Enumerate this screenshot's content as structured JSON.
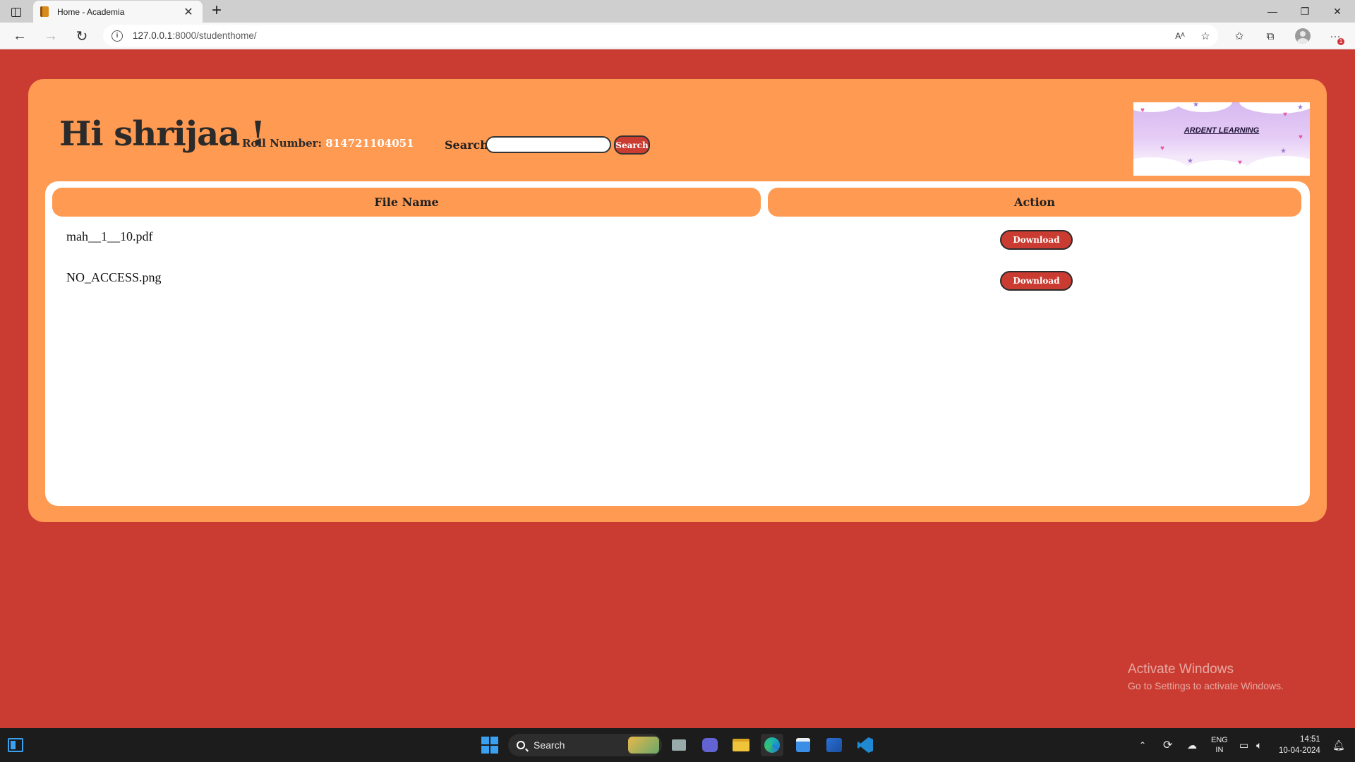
{
  "browser": {
    "tab_title": "Home - Academia",
    "url_host": "127.0.0.1",
    "url_rest": ":8000/studenthome/"
  },
  "page": {
    "greeting": "Hi shrijaa !",
    "roll_label": "Roll Number:",
    "roll_number": "814721104051",
    "search_label": "Search:",
    "search_value": "",
    "search_button": "Search",
    "banner_text": "ARDENT LEARNING",
    "table": {
      "headers": [
        "File Name",
        "Action"
      ],
      "rows": [
        {
          "file": "mah__1__10.pdf",
          "action": "Download"
        },
        {
          "file": "NO_ACCESS.png",
          "action": "Download"
        }
      ]
    }
  },
  "watermark": {
    "line1": "Activate Windows",
    "line2": "Go to Settings to activate Windows."
  },
  "taskbar": {
    "search_text": "Search",
    "lang": "ENG",
    "region": "IN",
    "time": "14:51",
    "date": "10-04-2024"
  },
  "colors": {
    "background": "#ca3c31",
    "card": "#ff9a52",
    "button": "#ca3c31"
  }
}
